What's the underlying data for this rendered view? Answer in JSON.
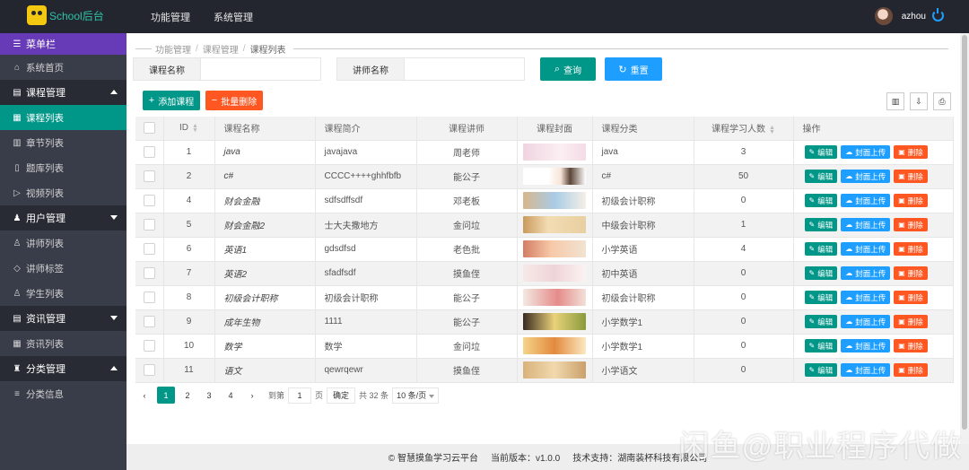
{
  "header": {
    "logo_text": "School后台",
    "nav": [
      "功能管理",
      "系统管理"
    ],
    "username": "azhou"
  },
  "sidebar": {
    "title": "菜单栏",
    "home": "系统首页",
    "groups": [
      {
        "label": "课程管理",
        "expanded": true,
        "items": [
          "课程列表",
          "章节列表",
          "题库列表",
          "视频列表"
        ]
      },
      {
        "label": "用户管理",
        "expanded": true,
        "items": [
          "讲师列表",
          "讲师标签",
          "学生列表"
        ]
      },
      {
        "label": "资讯管理",
        "expanded": true,
        "items": [
          "资讯列表"
        ]
      },
      {
        "label": "分类管理",
        "expanded": true,
        "items": [
          "分类信息"
        ]
      }
    ],
    "active_item": "课程列表"
  },
  "breadcrumb": [
    "功能管理",
    "课程管理",
    "课程列表"
  ],
  "search": {
    "course_name_label": "课程名称",
    "course_name_value": "",
    "teacher_name_label": "讲师名称",
    "teacher_name_value": "",
    "query_button": "查询",
    "reset_button": "重置"
  },
  "toolbar": {
    "add_button": "添加课程",
    "batch_delete_button": "批量删除",
    "icons": [
      "columns-icon",
      "export-icon",
      "print-icon"
    ]
  },
  "table": {
    "headers": [
      "ID",
      "课程名称",
      "课程简介",
      "课程讲师",
      "课程封面",
      "课程分类",
      "课程学习人数",
      "操作"
    ],
    "rows": [
      {
        "id": "1",
        "name": "java",
        "intro": "javajava",
        "teacher": "周老师",
        "category": "java",
        "students": "3"
      },
      {
        "id": "2",
        "name": "c#",
        "intro": "CCCC++++ghhfbfb",
        "teacher": "能公子",
        "category": "c#",
        "students": "50"
      },
      {
        "id": "4",
        "name": "财会金融",
        "intro": "sdfsdffsdf",
        "teacher": "邓老板",
        "category": "初级会计职称",
        "students": "0"
      },
      {
        "id": "5",
        "name": "财会金融2",
        "intro": "士大夫撒地方",
        "teacher": "金问垃",
        "category": "中级会计职称",
        "students": "1"
      },
      {
        "id": "6",
        "name": "英语1",
        "intro": "gdsdfsd",
        "teacher": "老色批",
        "category": "小学英语",
        "students": "4"
      },
      {
        "id": "7",
        "name": "英语2",
        "intro": "sfadfsdf",
        "teacher": "摸鱼侄",
        "category": "初中英语",
        "students": "0"
      },
      {
        "id": "8",
        "name": "初级会计职称",
        "intro": "初级会计职称",
        "teacher": "能公子",
        "category": "初级会计职称",
        "students": "0"
      },
      {
        "id": "9",
        "name": "成年生物",
        "intro": "1111",
        "teacher": "能公子",
        "category": "小学数学1",
        "students": "0"
      },
      {
        "id": "10",
        "name": "数学",
        "intro": "数学",
        "teacher": "金问垃",
        "category": "小学数学1",
        "students": "0"
      },
      {
        "id": "11",
        "name": "语文",
        "intro": "qewrqewr",
        "teacher": "摸鱼侄",
        "category": "小学语文",
        "students": "0"
      }
    ],
    "row_actions": {
      "edit": "编辑",
      "upload": "封面上传",
      "delete": "删除"
    }
  },
  "pagination": {
    "pages": [
      "1",
      "2",
      "3",
      "4"
    ],
    "current": "1",
    "goto_label": "到第",
    "goto_value": "1",
    "page_unit": "页",
    "confirm": "确定",
    "total": "共 32 条",
    "page_size": "10 条/页"
  },
  "footer": {
    "product": "© 智慧摸鱼学习云平台",
    "version": "当前版本：v1.0.0",
    "support": "技术支持：湖南装杯科技有限公司"
  },
  "watermark": "闲鱼@职业程序代做",
  "colors": {
    "topbar": "#23262e",
    "sidebar": "#393d49",
    "sidebar_header": "#673ab7",
    "accent_green": "#009688",
    "accent_blue": "#1e9fff",
    "accent_orange": "#ff5722"
  }
}
